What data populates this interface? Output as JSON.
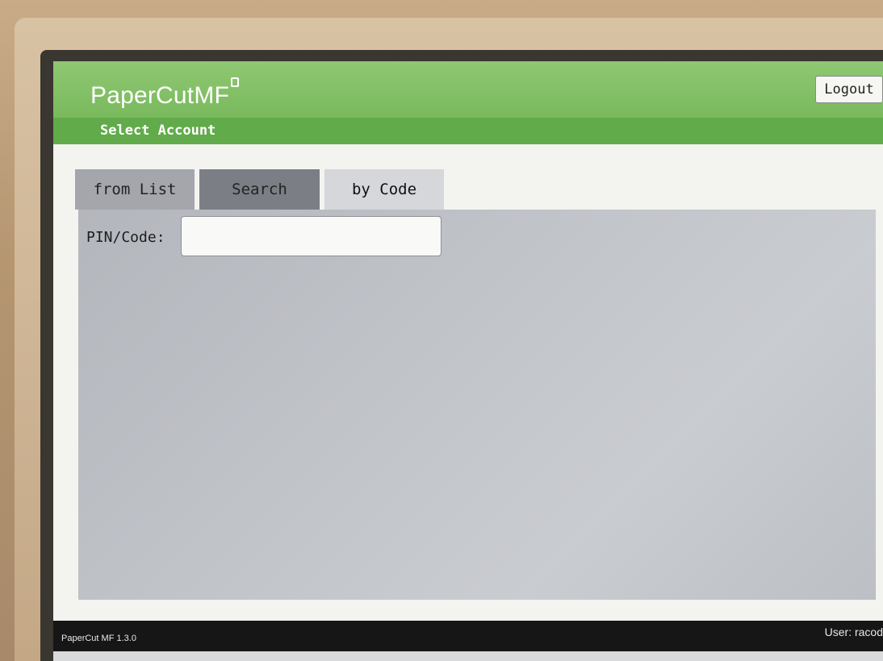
{
  "app": {
    "logo_text": "PaperCut",
    "logo_suffix": "MF"
  },
  "header": {
    "title": "Select Account",
    "logout_label": "Logout"
  },
  "tabs": [
    {
      "label": "from List",
      "active": false
    },
    {
      "label": "Search",
      "active": false
    },
    {
      "label": "by Code",
      "active": true
    }
  ],
  "form": {
    "pin_label": "PIN/Code:",
    "pin_value": ""
  },
  "footer": {
    "version": "PaperCut MF 1.3.0",
    "user": "User: racod"
  },
  "colors": {
    "header_green": "#7cbb5f",
    "subheader_green": "#62ab4b",
    "panel_gray": "#c2c5ca",
    "footer_black": "#161616"
  }
}
